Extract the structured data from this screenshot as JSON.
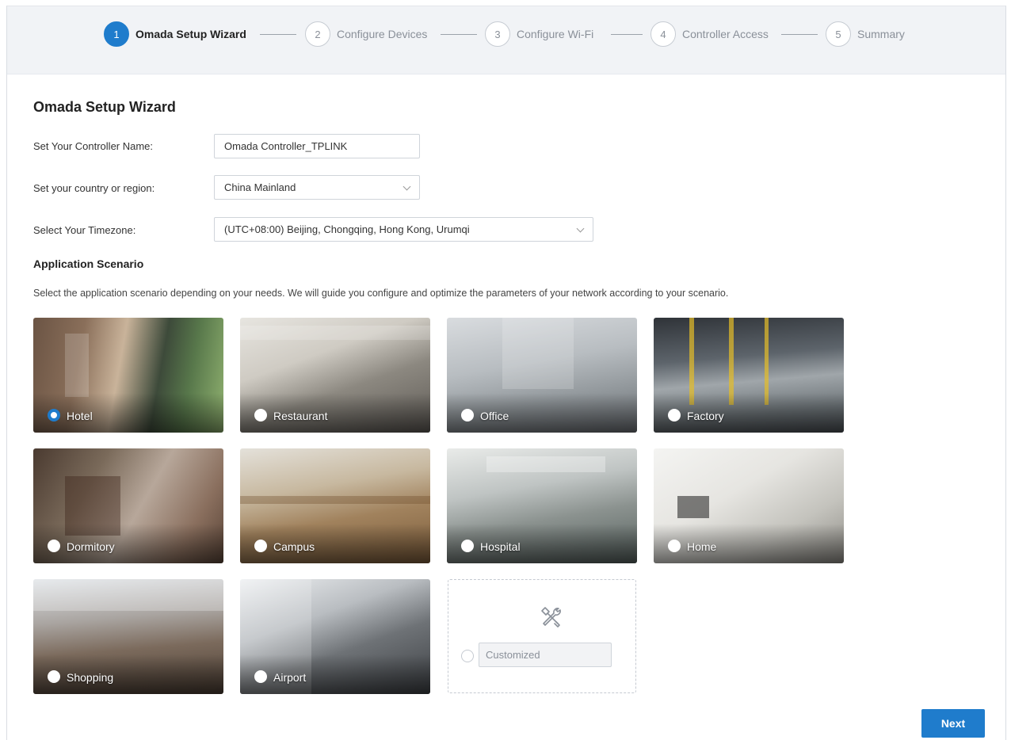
{
  "stepper": {
    "steps": [
      {
        "num": "1",
        "label": "Omada Setup Wizard"
      },
      {
        "num": "2",
        "label": "Configure Devices"
      },
      {
        "num": "3",
        "label": "Configure Wi-Fi"
      },
      {
        "num": "4",
        "label": "Controller Access"
      },
      {
        "num": "5",
        "label": "Summary"
      }
    ],
    "active_step": 1,
    "accent_color": "#1f7ccc"
  },
  "form": {
    "title": "Omada Setup Wizard",
    "controller_name_label": "Set Your Controller Name:",
    "controller_name_value": "Omada Controller_TPLINK",
    "country_label": "Set your country or region:",
    "country_value": "China Mainland",
    "timezone_label": "Select Your Timezone:",
    "timezone_value": "(UTC+08:00) Beijing, Chongqing, Hong Kong, Urumqi"
  },
  "scenario": {
    "title": "Application Scenario",
    "description": "Select the application scenario depending on your needs. We will guide you configure and optimize the parameters of your network according to your scenario.",
    "options": [
      {
        "label": "Hotel",
        "selected": true
      },
      {
        "label": "Restaurant",
        "selected": false
      },
      {
        "label": "Office",
        "selected": false
      },
      {
        "label": "Factory",
        "selected": false
      },
      {
        "label": "Dormitory",
        "selected": false
      },
      {
        "label": "Campus",
        "selected": false
      },
      {
        "label": "Hospital",
        "selected": false
      },
      {
        "label": "Home",
        "selected": false
      },
      {
        "label": "Shopping",
        "selected": false
      },
      {
        "label": "Airport",
        "selected": false
      }
    ],
    "customized_label": "Customized"
  },
  "actions": {
    "next_label": "Next"
  }
}
